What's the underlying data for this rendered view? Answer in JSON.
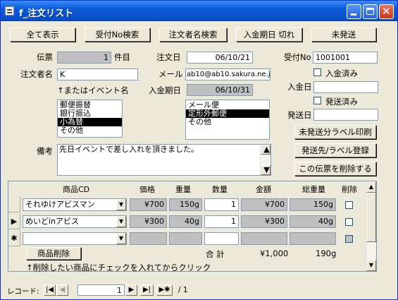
{
  "window": {
    "title": "f_注文リスト",
    "controls": {
      "minimize_icon": "minimize-icon",
      "maximize_icon": "maximize-icon",
      "close_icon": "close-icon",
      "close_glyph": "✕"
    }
  },
  "toolbar": {
    "show_all": "全て表示",
    "search_receipt_no": "受付No検索",
    "search_orderer": "注文者名検索",
    "due_expired": "入金期日 切れ",
    "not_shipped": "未発送"
  },
  "form": {
    "slip_label": "伝票",
    "slip_value": "1",
    "slip_unit": "件目",
    "order_date_label": "注文日",
    "order_date_value": "06/10/21",
    "receipt_no_label": "受付No",
    "receipt_no_value": "1001001",
    "orderer_label": "注文者名",
    "orderer_value": "K",
    "email_label": "メール",
    "email_value": "ab10@ab10.sakura.ne.jp",
    "paid_label": "入金済み",
    "event_note": "↑またはイベント名",
    "due_date_label": "入金期日",
    "due_date_value": "06/10/31",
    "payment_date_label": "入金日",
    "payment_date_value": "",
    "shipped_label": "発送済み",
    "ship_date_label": "発送日",
    "ship_date_value": "",
    "payment_methods": [
      "郵便振替",
      "銀行振込",
      "小為替",
      "その他"
    ],
    "payment_selected_index": 2,
    "shipping_methods": [
      "メール便",
      "定形外郵便",
      "その他"
    ],
    "shipping_selected_index": 1,
    "remarks_label": "備考",
    "remarks_value": "先日イベントで差し入れを頂きました。"
  },
  "actions": {
    "print_unshipped_labels": "未発送分ラベル印刷",
    "register_ship_label": "発送先/ラベル登録",
    "delete_slip": "この伝票を削除する"
  },
  "items_grid": {
    "headers": [
      "商品CD",
      "価格",
      "重量",
      "数量",
      "金額",
      "総重量",
      "削除"
    ],
    "rows": [
      {
        "product": "それゆけアビスマン",
        "price": "¥700",
        "weight": "150g",
        "qty": "1",
        "amount": "¥700",
        "total_weight": "150g",
        "delete": false
      },
      {
        "product": "めいどinアビス",
        "price": "¥300",
        "weight": "40g",
        "qty": "1",
        "amount": "¥300",
        "total_weight": "40g",
        "delete": false
      }
    ],
    "row_markers": [
      "",
      "▶",
      "✱"
    ],
    "delete_item_button": "商品削除",
    "total_label": "合 計",
    "total_amount": "¥1,000",
    "total_weight": "190g",
    "delete_note": "↑削除したい商品にチェックを入れてからクリック"
  },
  "record_nav": {
    "label": "レコード:",
    "current": "1",
    "total_text": "/ 1",
    "first_glyph": "|◀",
    "prev_glyph": "◀",
    "next_glyph": "▶",
    "last_glyph": "▶|",
    "new_glyph": "▶✱"
  }
}
